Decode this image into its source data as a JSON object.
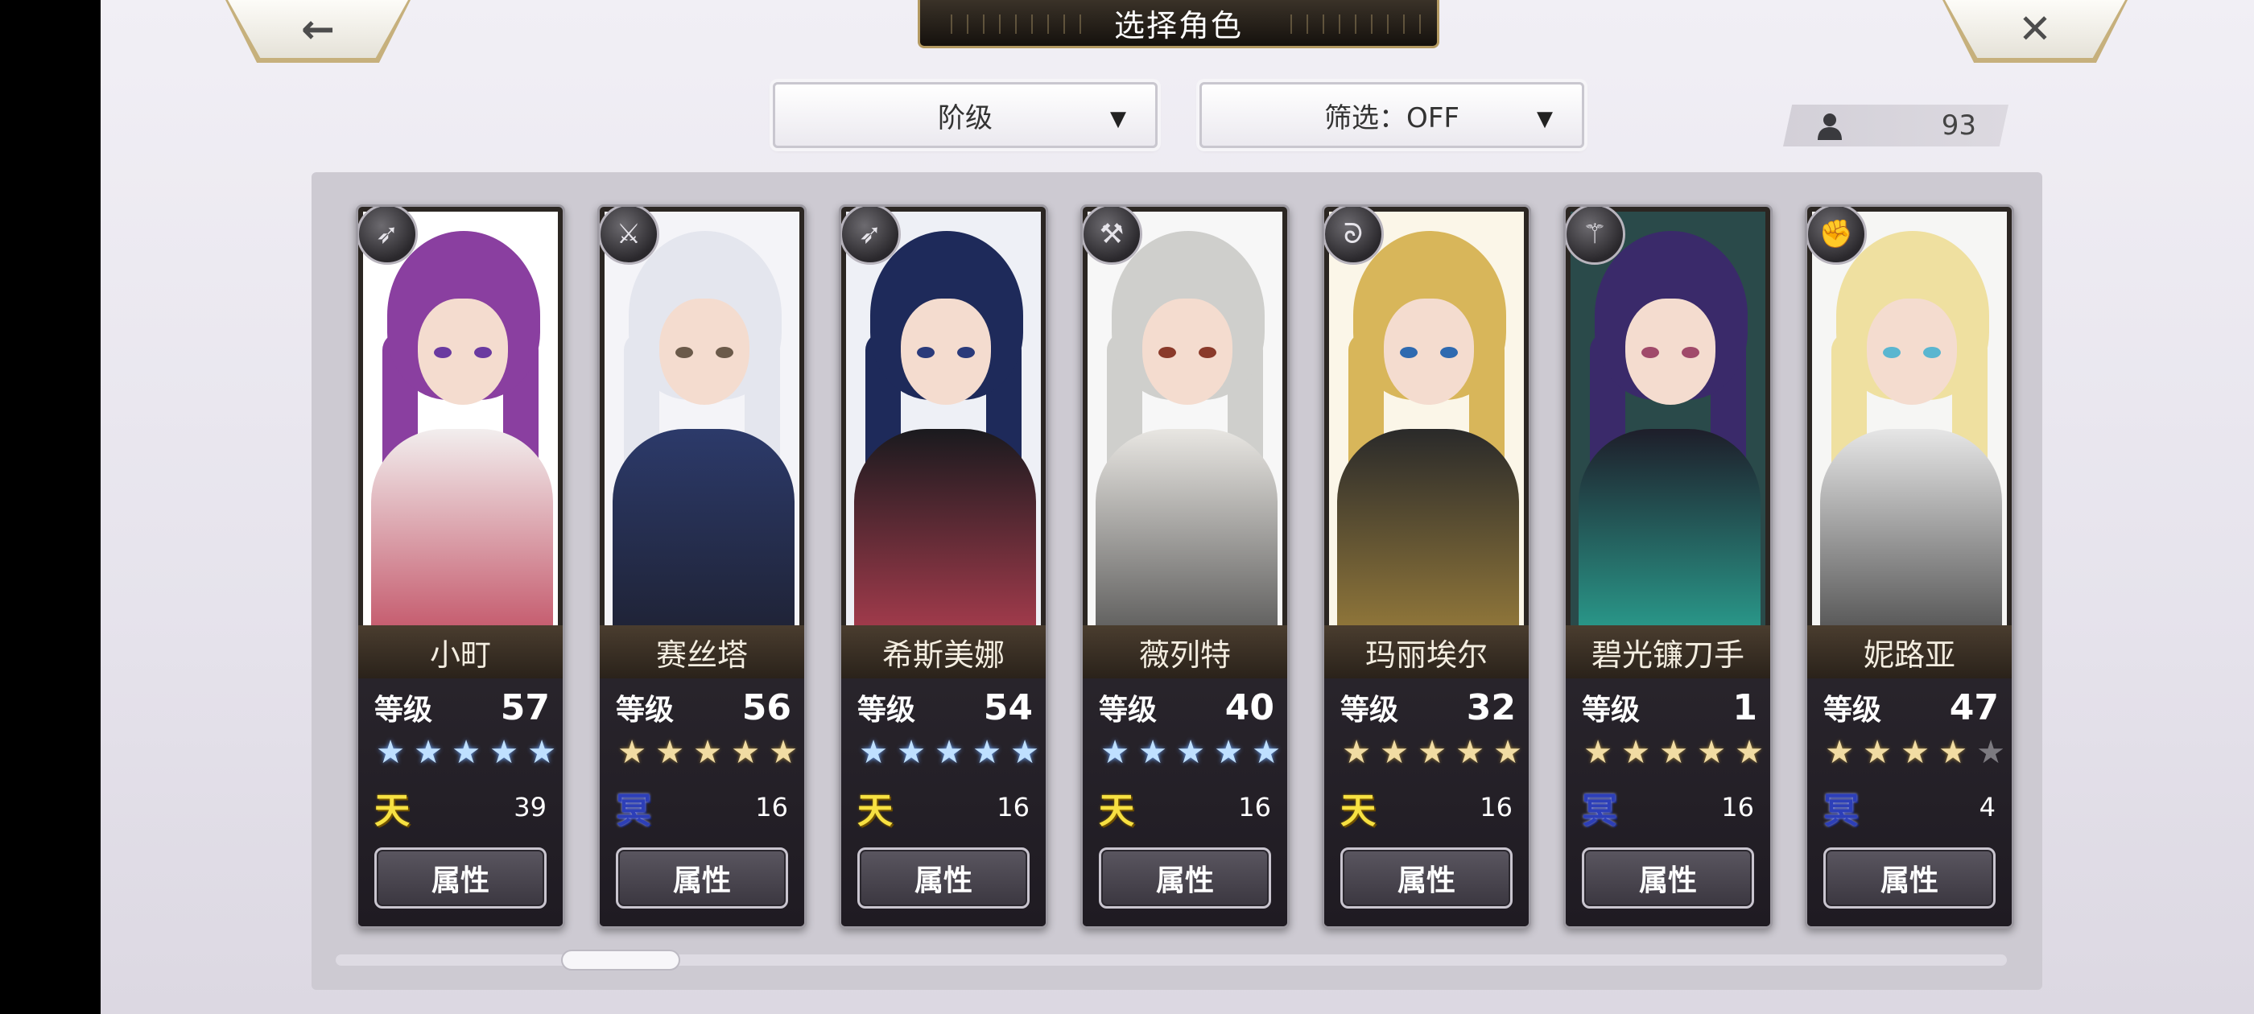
{
  "title": "选择角色",
  "back_icon": "←",
  "close_icon": "✕",
  "rank_dropdown": {
    "label": "阶级",
    "arrow": "▼"
  },
  "filter_dropdown": {
    "label": "筛选：OFF",
    "arrow": "▼"
  },
  "character_count": "93",
  "colors": {
    "sky_affinity": "#f7e142",
    "dark_affinity": "#2d3fb8",
    "blue_star": "#bfe0ff",
    "gold_star": "#f1dca3"
  },
  "cards": [
    {
      "name": "小町",
      "level_label": "等级",
      "level": "57",
      "stars": [
        "★",
        "★",
        "★",
        "★",
        "★"
      ],
      "star_color": "blue",
      "stars_filled": 5,
      "affinity": "天",
      "affinity_type": "sky",
      "count": "39",
      "button": "属性",
      "weapon_icon": "spear-icon",
      "weapon_glyph": "➶"
    },
    {
      "name": "赛丝塔",
      "level_label": "等级",
      "level": "56",
      "stars": [
        "★",
        "★",
        "★",
        "★",
        "★"
      ],
      "star_color": "gold",
      "stars_filled": 5,
      "affinity": "冥",
      "affinity_type": "dark",
      "count": "16",
      "button": "属性",
      "weapon_icon": "sword-icon",
      "weapon_glyph": "⚔"
    },
    {
      "name": "希斯美娜",
      "level_label": "等级",
      "level": "54",
      "stars": [
        "★",
        "★",
        "★",
        "★",
        "★"
      ],
      "star_color": "blue",
      "stars_filled": 5,
      "affinity": "天",
      "affinity_type": "sky",
      "count": "16",
      "button": "属性",
      "weapon_icon": "spear-icon",
      "weapon_glyph": "➶"
    },
    {
      "name": "薇列特",
      "level_label": "等级",
      "level": "40",
      "stars": [
        "★",
        "★",
        "★",
        "★",
        "★"
      ],
      "star_color": "blue",
      "stars_filled": 5,
      "affinity": "天",
      "affinity_type": "sky",
      "count": "16",
      "button": "属性",
      "weapon_icon": "hammer-icon",
      "weapon_glyph": "⚒"
    },
    {
      "name": "玛丽埃尔",
      "level_label": "等级",
      "level": "32",
      "stars": [
        "★",
        "★",
        "★",
        "★",
        "★"
      ],
      "star_color": "gold",
      "stars_filled": 5,
      "affinity": "天",
      "affinity_type": "sky",
      "count": "16",
      "button": "属性",
      "weapon_icon": "staff-icon",
      "weapon_glyph": "ᘐ"
    },
    {
      "name": "碧光镰刀手",
      "level_label": "等级",
      "level": "1",
      "stars": [
        "★",
        "★",
        "★",
        "★",
        "★"
      ],
      "star_color": "gold",
      "stars_filled": 5,
      "affinity": "冥",
      "affinity_type": "dark",
      "count": "16",
      "button": "属性",
      "weapon_icon": "axe-icon",
      "weapon_glyph": "⚚"
    },
    {
      "name": "妮路亚",
      "level_label": "等级",
      "level": "47",
      "stars": [
        "★",
        "★",
        "★",
        "★",
        "★"
      ],
      "star_color": "gold",
      "stars_filled": 4,
      "affinity": "冥",
      "affinity_type": "dark",
      "count": "4",
      "button": "属性",
      "weapon_icon": "fist-icon",
      "weapon_glyph": "✊"
    }
  ]
}
